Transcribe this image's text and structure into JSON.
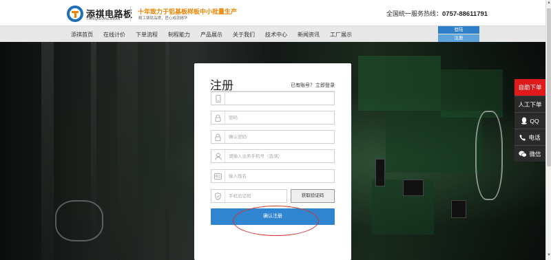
{
  "header": {
    "brand_name": "添祺电路板",
    "brand_pinyin": "TIANQIDIANLUBAN",
    "slogan": "十年致力于铝基板样板中小批量生产",
    "subslogan": "精工铸就品牌，匠心成就精华",
    "hotline_label": "全国统一服务热线：",
    "hotline_number": "0757-88611791"
  },
  "nav": {
    "items": [
      {
        "label": "添祺首页"
      },
      {
        "label": "在线计价"
      },
      {
        "label": "下单流程"
      },
      {
        "label": "制程能力"
      },
      {
        "label": "产品展示"
      },
      {
        "label": "关于我们"
      },
      {
        "label": "技术中心"
      },
      {
        "label": "新闻资讯"
      },
      {
        "label": "工厂展示"
      }
    ],
    "login": "登陆",
    "register": "注册"
  },
  "form": {
    "title": "注册",
    "has_account": "已有账号？",
    "login_link": "立即登录",
    "fields": [
      {
        "placeholder": "",
        "icon": "phone-icon"
      },
      {
        "placeholder": "密码",
        "icon": "lock-icon"
      },
      {
        "placeholder": "确认密码",
        "icon": "lock-icon"
      },
      {
        "placeholder": "请输入业务手机号（选填）",
        "icon": "user-icon"
      },
      {
        "placeholder": "输入姓名",
        "icon": "id-card-icon"
      },
      {
        "placeholder": "手机验证码",
        "icon": "shield-icon"
      }
    ],
    "sms_button": "获取验证码",
    "submit": "确认注册"
  },
  "side_bar": {
    "items": [
      {
        "label": "自助下单"
      },
      {
        "label": "人工下单"
      },
      {
        "label": "QQ",
        "icon": "qq-icon"
      },
      {
        "label": "电话",
        "icon": "phone-icon"
      },
      {
        "label": "微信",
        "icon": "wechat-icon"
      }
    ]
  },
  "colors": {
    "brand_orange": "#f08300",
    "primary_blue": "#2f85d0",
    "side_red": "#e01a1a",
    "annotation_red": "#d9342b"
  }
}
